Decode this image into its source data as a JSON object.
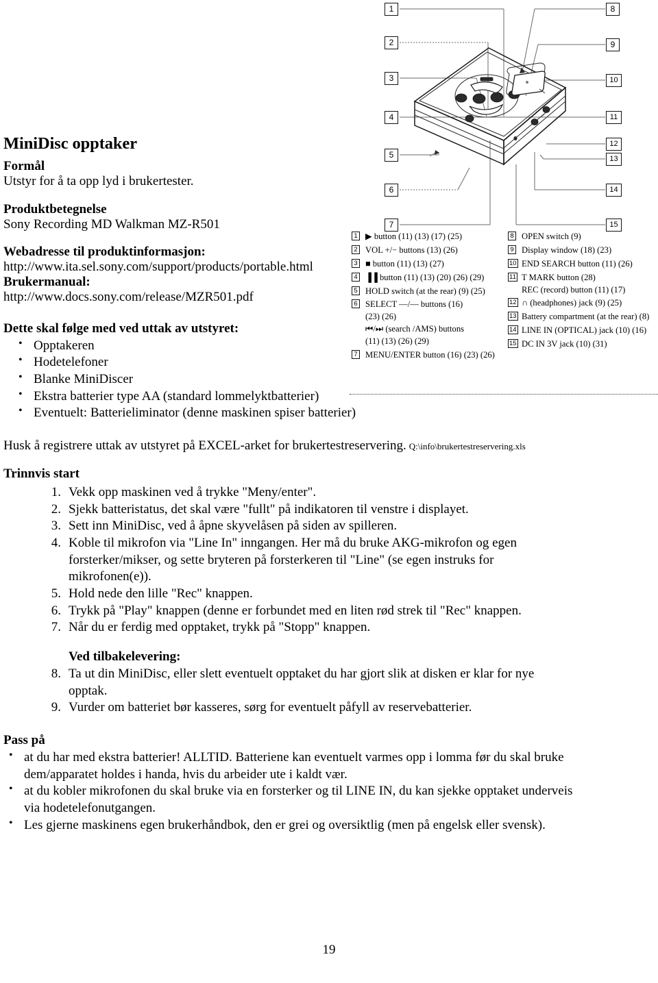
{
  "document": {
    "page_number": "19",
    "title": "MiniDisc opptaker",
    "sections": {
      "formal_head": "Formål",
      "formal_text": "Utstyr for å ta opp lyd i brukertester.",
      "produkt_head": "Produktbetegnelse",
      "produkt_text": "Sony Recording MD Walkman MZ-R501",
      "web_head": "Webadresse til produktinformasjon:",
      "web_url": "http://www.ita.sel.sony.com/support/products/portable.html",
      "manual_head": "Brukermanual:",
      "manual_url": "http://www.docs.sony.com/release/MZR501.pdf",
      "included_head": "Dette skal følge med ved uttak av utstyret:",
      "included_items": [
        "Opptakeren",
        "Hodetelefoner",
        "Blanke MiniDiscer",
        "Ekstra batterier type AA (standard lommelyktbatterier)",
        "Eventuelt: Batterieliminator (denne maskinen spiser batterier)"
      ],
      "excel_note": "Husk å registrere uttak av utstyret på EXCEL-arket for brukertestreservering.",
      "excel_path": "Q:\\info\\brukertestreservering.xls",
      "steps_head": "Trinnvis start",
      "steps": [
        {
          "num": "1.",
          "text": "Vekk opp maskinen ved å trykke \"Meny/enter\"."
        },
        {
          "num": "2.",
          "text": "Sjekk batteristatus, det skal være \"fullt\" på indikatoren til venstre i displayet."
        },
        {
          "num": "3.",
          "text": "Sett inn MiniDisc, ved å åpne skyvelåsen på siden av spilleren."
        },
        {
          "num": "4.",
          "text": "Koble til mikrofon via \"Line In\" inngangen. Her må du bruke AKG-mikrofon og egen forsterker/mikser, og sette bryteren på forsterkeren til \"Line\" (se egen instruks for mikrofonen(e))."
        },
        {
          "num": "5.",
          "text": "Hold nede den lille \"Rec\" knappen."
        },
        {
          "num": "6.",
          "text": "Trykk på \"Play\" knappen (denne er forbundet med en liten rød strek til \"Rec\" knappen."
        },
        {
          "num": "7.",
          "text": "Når du er ferdig med opptaket, trykk på \"Stopp\" knappen."
        }
      ],
      "return_head": "Ved tilbakelevering:",
      "return_steps": [
        {
          "num": "8.",
          "text": "Ta ut din MiniDisc, eller slett eventuelt opptaket du har gjort slik at disken er klar for nye opptak."
        },
        {
          "num": "9.",
          "text": "Vurder om batteriet bør kasseres, sørg for eventuelt påfyll av reservebatterier."
        }
      ],
      "notice_head": "Pass på",
      "notice_items": [
        "at du har med ekstra batterier! ALLTID. Batteriene kan eventuelt varmes opp i lomma før du skal bruke dem/apparatet holdes i handa, hvis du arbeider ute i kaldt vær.",
        "at du kobler mikrofonen du skal bruke via en forsterker og til LINE IN, du kan sjekke opptaket underveis via hodetelefonutgangen.",
        "Les gjerne maskinens egen brukerhåndbok, den er grei og oversiktlig (men på engelsk eller svensk)."
      ]
    }
  },
  "diagram": {
    "callouts": [
      "1",
      "2",
      "3",
      "4",
      "5",
      "6",
      "7",
      "8",
      "9",
      "10",
      "11",
      "12",
      "13",
      "14",
      "15"
    ],
    "legend_left": [
      {
        "num": "1",
        "text": "▶ button  (11) (13) (17) (25)"
      },
      {
        "num": "2",
        "text": "VOL +/− buttons  (13) (26)"
      },
      {
        "num": "3",
        "text": "■ button  (11) (13) (27)"
      },
      {
        "num": "4",
        "text": "▐▐ button  (11) (13) (20) (26) (29)"
      },
      {
        "num": "5",
        "text": "HOLD switch (at the rear)  (9) (25)"
      },
      {
        "num": "6",
        "text": "SELECT —/— buttons  (16)",
        "line2": "(23) (26)",
        "line3": "⏮/⏭ (search /AMS) buttons",
        "line4": "(11) (13) (26) (29)"
      },
      {
        "num": "7",
        "text": "MENU/ENTER button  (16) (23) (26)"
      }
    ],
    "legend_right": [
      {
        "num": "8",
        "text": "OPEN switch  (9)"
      },
      {
        "num": "9",
        "text": "Display window  (18) (23)"
      },
      {
        "num": "10",
        "text": "END SEARCH button  (11) (26)"
      },
      {
        "num": "11",
        "text": "T MARK button  (28)",
        "line2": "REC (record) button  (11) (17)"
      },
      {
        "num": "12",
        "text": "∩ (headphones) jack  (9) (25)"
      },
      {
        "num": "13",
        "text": "Battery compartment (at the rear)  (8)"
      },
      {
        "num": "14",
        "text": "LINE IN (OPTICAL) jack  (10) (16)"
      },
      {
        "num": "15",
        "text": "DC IN 3V jack  (10) (31)"
      }
    ]
  }
}
